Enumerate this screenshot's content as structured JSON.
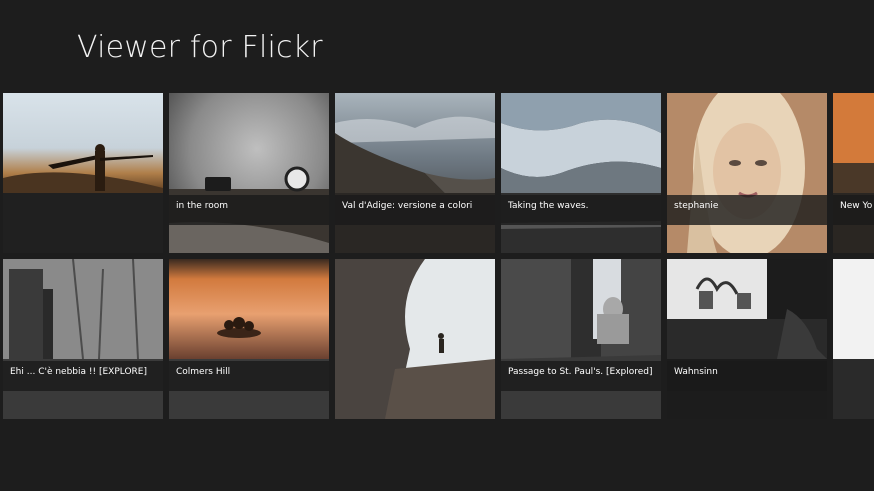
{
  "app": {
    "title": "Viewer for Flickr"
  },
  "tiles": [
    {
      "caption": ""
    },
    {
      "caption": "in the room"
    },
    {
      "caption": "Val d'Adige: versione a colori"
    },
    {
      "caption": "Taking the waves."
    },
    {
      "caption": "stephanie"
    },
    {
      "caption": "New Yo"
    },
    {
      "caption": "Ehi ... C'è nebbia !!  [EXPLORE]"
    },
    {
      "caption": "Colmers Hill"
    },
    {
      "caption": ""
    },
    {
      "caption": "Passage to St. Paul's. [Explored]"
    },
    {
      "caption": "Wahnsinn"
    },
    {
      "caption": ""
    }
  ]
}
